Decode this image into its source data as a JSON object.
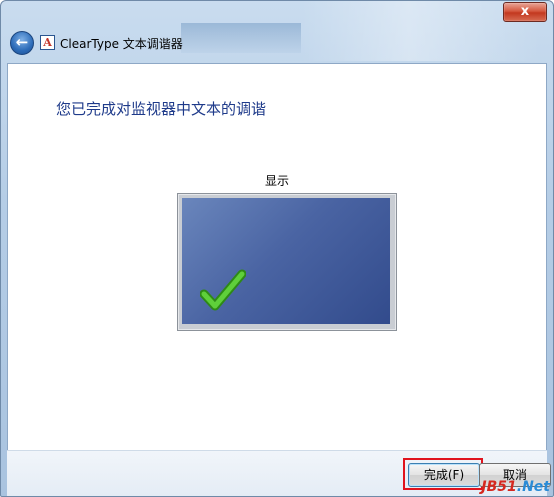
{
  "window": {
    "title": "ClearType 文本调谐器",
    "app_icon_glyph": "A",
    "close_glyph": "x",
    "back_glyph": "←"
  },
  "main": {
    "heading": "您已完成对监视器中文本的调谐",
    "display_label": "显示",
    "check_icon": "check-icon"
  },
  "footer": {
    "finish_label": "完成(F)",
    "cancel_label": "取消"
  },
  "watermark": {
    "part1": "JB51",
    "part2": ".Net"
  },
  "colors": {
    "heading": "#1e3a8a",
    "highlight": "#e0141e",
    "check": "#3aa320",
    "screen": "#4a64a3"
  }
}
